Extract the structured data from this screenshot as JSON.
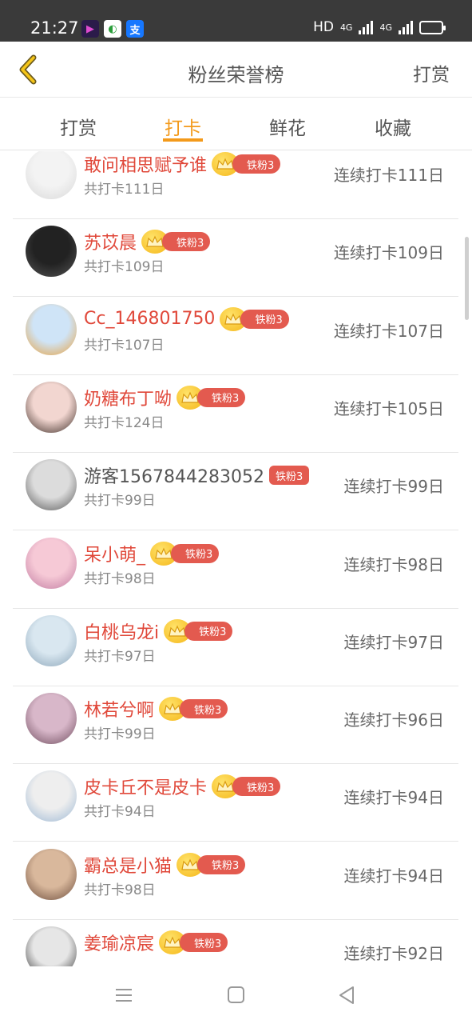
{
  "status_bar": {
    "time": "21:27",
    "hd_label": "HD",
    "net1": "4G",
    "net2": "4G"
  },
  "header": {
    "title": "粉丝荣誉榜",
    "right_label": "打赏"
  },
  "tabs": [
    {
      "label": "打赏"
    },
    {
      "label": "打卡"
    },
    {
      "label": "鲜花"
    },
    {
      "label": "收藏"
    }
  ],
  "active_tab": "打卡",
  "badge_label": "铁粉3",
  "rows": [
    {
      "name": "敢问相思赋予谁",
      "total": "共打卡111日",
      "streak": "连续打卡111日"
    },
    {
      "name": "苏苡晨",
      "total": "共打卡109日",
      "streak": "连续打卡109日"
    },
    {
      "name": "Cc_146801750",
      "total": "共打卡107日",
      "streak": "连续打卡107日"
    },
    {
      "name": "奶糖布丁呦",
      "total": "共打卡124日",
      "streak": "连续打卡105日"
    },
    {
      "name": "游客1567844283052",
      "total": "共打卡99日",
      "streak": "连续打卡99日"
    },
    {
      "name": "呆小萌_",
      "total": "共打卡98日",
      "streak": "连续打卡98日"
    },
    {
      "name": "白桃乌龙i",
      "total": "共打卡97日",
      "streak": "连续打卡97日"
    },
    {
      "name": "林若兮啊",
      "total": "共打卡99日",
      "streak": "连续打卡96日"
    },
    {
      "name": "皮卡丘不是皮卡",
      "total": "共打卡94日",
      "streak": "连续打卡94日"
    },
    {
      "name": "霸总是小猫",
      "total": "共打卡98日",
      "streak": "连续打卡94日"
    },
    {
      "name": "姜瑜凉宸",
      "total": "",
      "streak": "连续打卡92日"
    }
  ],
  "colors": {
    "accent": "#f39a1b",
    "name_red": "#e0483a",
    "badge_red": "#e35a4f"
  }
}
